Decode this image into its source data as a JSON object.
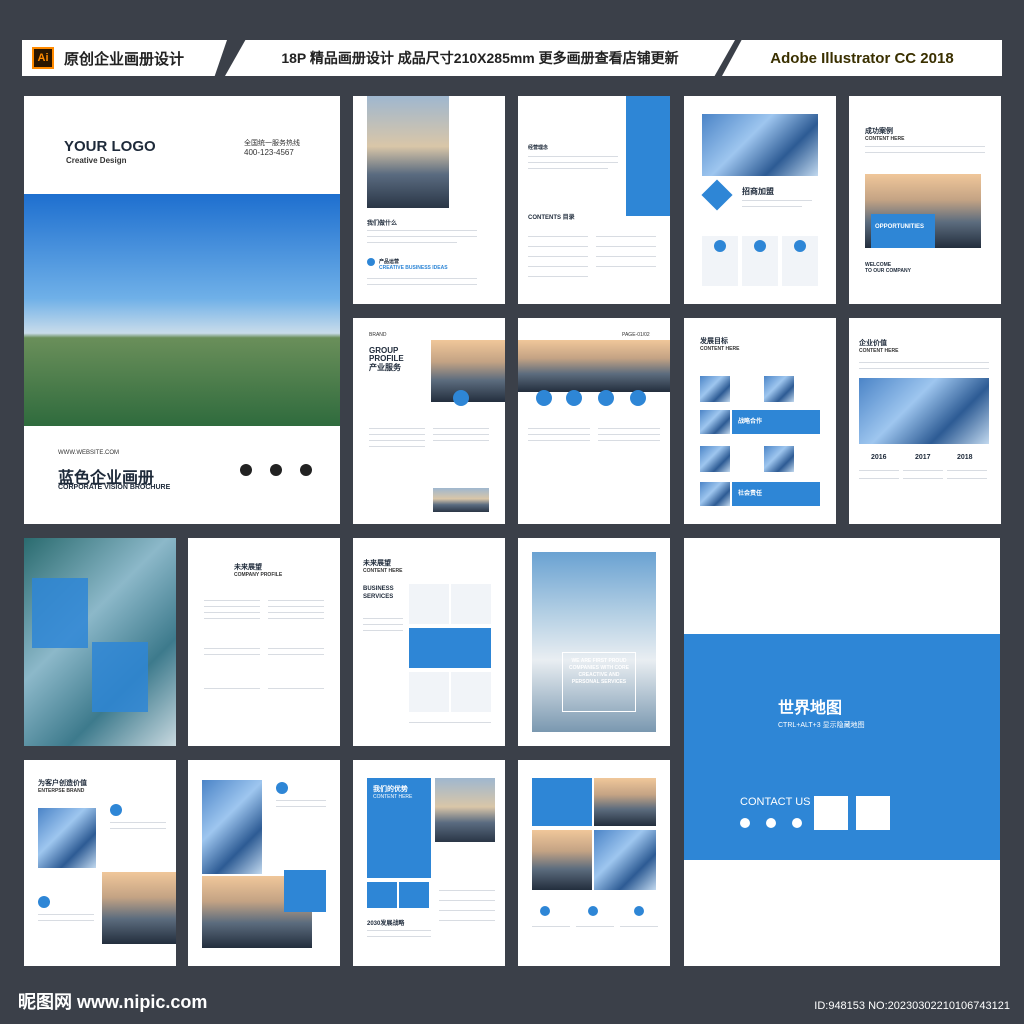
{
  "header": {
    "ai_badge": "Ai",
    "left_title": "原创企业画册设计",
    "middle_title": "18P 精品画册设计  成品尺寸210X285mm  更多画册查看店铺更新",
    "right_title": "Adobe Illustrator CC 2018"
  },
  "cover": {
    "logo": "YOUR LOGO",
    "logo_sub": "Creative Design",
    "hotline_label": "全国统一服务热线",
    "hotline": "400-123-4567",
    "website": "WWW.WEBSITE.COM",
    "title_cn": "蓝色企业画册",
    "title_en": "CORPORATE VISION BROCHURE"
  },
  "pages": {
    "p2_title": "我们做什么",
    "p2_sub": "产品运营",
    "p2_sub_en": "CREATIVE BUSINESS IDEAS",
    "p3_heading": "经营理念",
    "p3_contents": "CONTENTS 目录",
    "p4_title": "招商加盟",
    "p5_title": "成功案例",
    "p5_sub": "CONTENT HERE",
    "p5_opp": "OPPORTUNITIES",
    "p5_welcome": "WELCOME",
    "p5_welcome2": "TO OUR COMPANY",
    "p6_brand": "BRAND",
    "p6_group": "GROUP",
    "p6_profile": "PROFILE",
    "p6_cn": "产业服务",
    "p7_page": "PAGE-01/02",
    "p8_title": "发展目标",
    "p8_sub": "CONTENT HERE",
    "p8_tag1": "战略合作",
    "p8_tag2": "社会责任",
    "p9_title": "企业价值",
    "p9_sub": "CONTENT HERE",
    "p9_years": [
      "2016",
      "2017",
      "2018"
    ],
    "p11_title": "未来展望",
    "p11_sub": "COMPANY PROFILE",
    "p12_title": "未来展望",
    "p12_sub": "CONTENT HERE",
    "p12_bs": "BUSINESS",
    "p12_sv": "SERVICES",
    "p13_quote": "WE ARE FIRST PROUD COMPANIES WITH CORE CREACTIVE AND PERSONAL SERVICES",
    "p14_title": "世界地图",
    "p14_sub": "CTRL+ALT+3 显示隐藏地图",
    "p14_contact": "CONTACT US",
    "p15_title": "为客户创造价值",
    "p15_sub": "ENTERPSE BRAND",
    "p17_title": "我们的优势",
    "p17_sub": "CONTENT HERE",
    "p17_2030": "2030发展战略"
  },
  "footer": {
    "left": "昵图网 www.nipic.com",
    "right": "ID:948153 NO:20230302210106743121"
  }
}
